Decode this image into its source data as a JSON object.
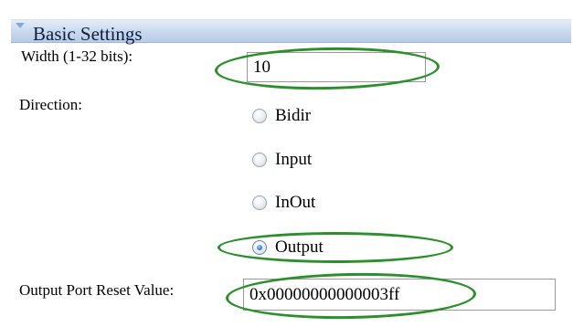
{
  "section": {
    "title": "Basic Settings",
    "collapse_icon": "triangle-down-icon"
  },
  "width": {
    "label": "Width (1-32 bits):",
    "value": "10"
  },
  "direction": {
    "label": "Direction:",
    "options": [
      {
        "label": "Bidir",
        "checked": false
      },
      {
        "label": "Input",
        "checked": false
      },
      {
        "label": "InOut",
        "checked": false
      },
      {
        "label": "Output",
        "checked": true
      }
    ]
  },
  "reset_value": {
    "label": "Output Port Reset Value:",
    "value": "0x00000000000003ff"
  },
  "colors": {
    "header_gradient_top": "#e4ecf7",
    "header_gradient_bottom": "#b7cbe7",
    "annotation_highlight": "#2c8f2c",
    "radio_selected": "#2f7fd8"
  }
}
